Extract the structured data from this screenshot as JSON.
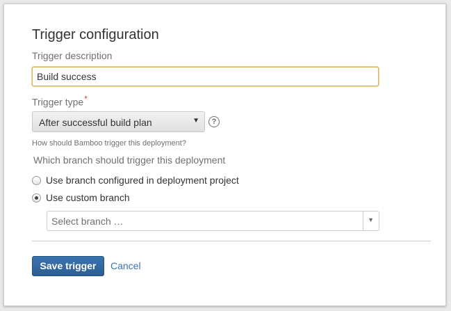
{
  "dialog": {
    "title": "Trigger configuration",
    "description_label": "Trigger description",
    "description_value": "Build success",
    "type_label": "Trigger type",
    "required_mark": "*",
    "type_value": "After successful build plan",
    "type_arrow": "▼",
    "help_glyph": "?",
    "type_hint": "How should Bamboo trigger this deployment?",
    "branch_question": "Which branch should trigger this deployment",
    "branch_options": [
      {
        "label": "Use branch configured in deployment project",
        "selected": false
      },
      {
        "label": "Use custom branch",
        "selected": true
      }
    ],
    "branch_select_placeholder": "Select branch …",
    "branch_select_caret": "▼",
    "save_label": "Save trigger",
    "cancel_label": "Cancel"
  },
  "colors": {
    "accent": "#3b73af",
    "required": "#d04437",
    "focus_border": "#d9b35e"
  }
}
